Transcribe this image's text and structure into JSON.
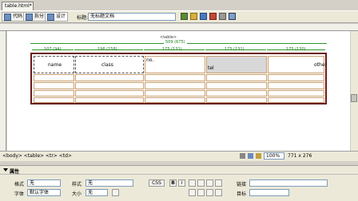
{
  "document_tab": "table.html*",
  "toolbar": {
    "code_label": "代码",
    "split_label": "拆分",
    "design_label": "设计",
    "title_label": "标题:",
    "title_value": "无标题文档"
  },
  "table": {
    "caption": "<table>",
    "total_width_label": "509 (675)",
    "col_widths": [
      "107 (94)",
      "196 (158)",
      "175 (131)",
      "175 (131)",
      "175 (130)"
    ],
    "row1": {
      "c1": "name",
      "c2": "class",
      "c3": "no.",
      "c4": "tel",
      "c5": "other"
    }
  },
  "status": {
    "tag_path": "<body> <table> <tr> <td>",
    "zoom": "100%",
    "size": "771 x 276"
  },
  "properties": {
    "panel_title": "属性",
    "format_label": "格式",
    "format_value": "无",
    "style_label": "样式",
    "style_value": "无",
    "css_button": "CSS",
    "bold": "B",
    "italic": "I",
    "link_label": "链接",
    "font_label": "字体",
    "font_value": "默认字体",
    "size_label": "大小",
    "size_value": "无",
    "target_label": "目标"
  }
}
